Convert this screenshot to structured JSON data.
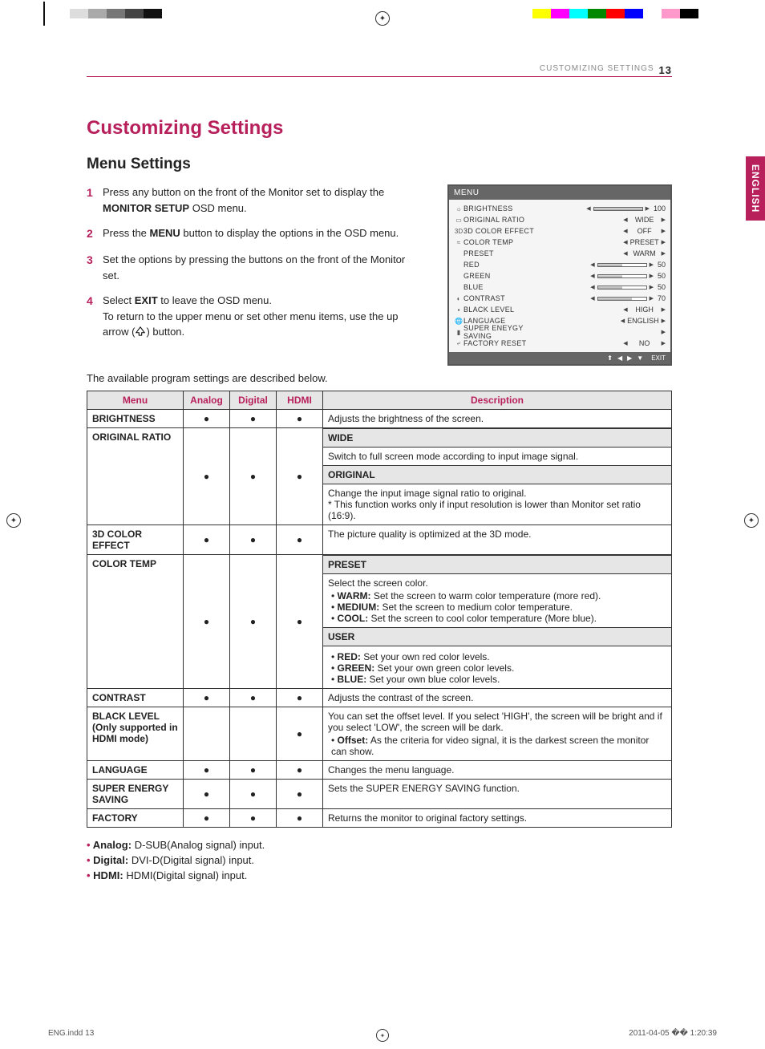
{
  "header": {
    "section": "CUSTOMIZING SETTINGS",
    "page": "13"
  },
  "title": "Customizing Settings",
  "subtitle": "Menu Settings",
  "sidetab": "ENGLISH",
  "steps": [
    {
      "num": "1",
      "t1": "Press any button on the front of the Monitor set to display the ",
      "b1": "MONITOR SETUP",
      "t2": " OSD menu."
    },
    {
      "num": "2",
      "t1": "Press the ",
      "b1": "MENU",
      "t2": " button to display the options in the OSD menu."
    },
    {
      "num": "3",
      "t1": "Set the options by pressing the buttons on the front of the Monitor set.",
      "b1": "",
      "t2": ""
    },
    {
      "num": "4",
      "t1": "Select ",
      "b1": "EXIT",
      "t2": " to leave the OSD menu.",
      "extra": "To return to the upper menu or set other menu items, use the up arrow (",
      "extra2": ") button."
    }
  ],
  "osd": {
    "title": "MENU",
    "rows": [
      {
        "icon": "☼",
        "label": "BRIGHTNESS",
        "type": "slider",
        "fill": 100,
        "num": "100"
      },
      {
        "icon": "▭",
        "label": "ORIGINAL RATIO",
        "type": "lr",
        "val": "WIDE"
      },
      {
        "icon": "3D",
        "label": "3D COLOR EFFECT",
        "type": "lr",
        "val": "OFF"
      },
      {
        "icon": "≈",
        "label": "COLOR TEMP",
        "type": "lr",
        "val": "PRESET"
      },
      {
        "icon": "",
        "label": "PRESET",
        "type": "lr",
        "val": "WARM"
      },
      {
        "icon": "",
        "label": "RED",
        "type": "slider",
        "fill": 50,
        "num": "50"
      },
      {
        "icon": "",
        "label": "GREEN",
        "type": "slider",
        "fill": 50,
        "num": "50"
      },
      {
        "icon": "",
        "label": "BLUE",
        "type": "slider",
        "fill": 50,
        "num": "50"
      },
      {
        "icon": "◐",
        "label": "CONTRAST",
        "type": "slider",
        "fill": 70,
        "num": "70"
      },
      {
        "icon": "▪",
        "label": "BLACK LEVEL",
        "type": "lr",
        "val": "HIGH"
      },
      {
        "icon": "🌐",
        "label": "LANGUAGE",
        "type": "lr",
        "val": "ENGLISH"
      },
      {
        "icon": "▮",
        "label": "SUPER ENEYGY SAVING",
        "type": "r",
        "val": ""
      },
      {
        "icon": "⤶",
        "label": "FACTORY RESET",
        "type": "lr",
        "val": "NO"
      }
    ],
    "exit": "EXIT"
  },
  "available_text": "The available program settings are described below.",
  "table": {
    "headers": [
      "Menu",
      "Analog",
      "Digital",
      "HDMI",
      "Description"
    ],
    "rows": {
      "brightness": {
        "name": "BRIGHTNESS",
        "a": "●",
        "d": "●",
        "h": "●",
        "desc": "Adjusts the brightness of the screen."
      },
      "ratio": {
        "name": "ORIGINAL RATIO",
        "a": "●",
        "d": "●",
        "h": "●",
        "wide_h": "WIDE",
        "wide_d": "Switch to full screen mode according to input image signal.",
        "orig_h": "ORIGINAL",
        "orig_d": "Change the input image signal ratio to original.\n* This function works only if input resolution is lower than Monitor set ratio (16:9)."
      },
      "color3d": {
        "name": "3D COLOR EFFECT",
        "a": "●",
        "d": "●",
        "h": "●",
        "desc": "The picture quality is optimized at the 3D mode."
      },
      "colortemp": {
        "name": "COLOR TEMP",
        "a": "●",
        "d": "●",
        "h": "●",
        "preset_h": "PRESET",
        "preset_d": "Select the screen color.",
        "warm_l": "WARM:",
        "warm_d": " Set the screen to warm color temperature (more red).",
        "med_l": "MEDIUM:",
        "med_d": " Set the screen to medium color temperature.",
        "cool_l": "COOL:",
        "cool_d": " Set the screen to cool color temperature (More blue).",
        "user_h": "USER",
        "red_l": "RED:",
        "red_d": " Set your own red color levels.",
        "green_l": "GREEN:",
        "green_d": " Set your own green color levels.",
        "blue_l": "BLUE:",
        "blue_d": " Set your own blue color levels."
      },
      "contrast": {
        "name": "CONTRAST",
        "a": "●",
        "d": "●",
        "h": "●",
        "desc": "Adjusts the contrast of the screen."
      },
      "black": {
        "name": "BLACK LEVEL (Only supported in HDMI mode)",
        "a": "",
        "d": "",
        "h": "●",
        "desc": "You can set the offset level. If you select 'HIGH', the screen will be bright and if you select 'LOW', the screen will be dark.",
        "off_l": "Offset:",
        "off_d": " As the criteria for video signal, it is the darkest screen the monitor can show."
      },
      "language": {
        "name": "LANGUAGE",
        "a": "●",
        "d": "●",
        "h": "●",
        "desc": "Changes the menu language."
      },
      "ses": {
        "name": "SUPER ENERGY SAVING",
        "a": "●",
        "d": "●",
        "h": "●",
        "desc": "Sets the SUPER ENERGY SAVING function."
      },
      "factory": {
        "name": "FACTORY",
        "a": "●",
        "d": "●",
        "h": "●",
        "desc": "Returns the monitor to original factory settings."
      }
    }
  },
  "legend": {
    "analog_l": "Analog:",
    "analog_d": " D-SUB(Analog signal) input.",
    "digital_l": "Digital:",
    "digital_d": " DVI-D(Digital signal) input.",
    "hdmi_l": "HDMI:",
    "hdmi_d": " HDMI(Digital signal) input."
  },
  "footer": {
    "left": "ENG.indd   13",
    "right": "2011-04-05   �� 1:20:39"
  }
}
